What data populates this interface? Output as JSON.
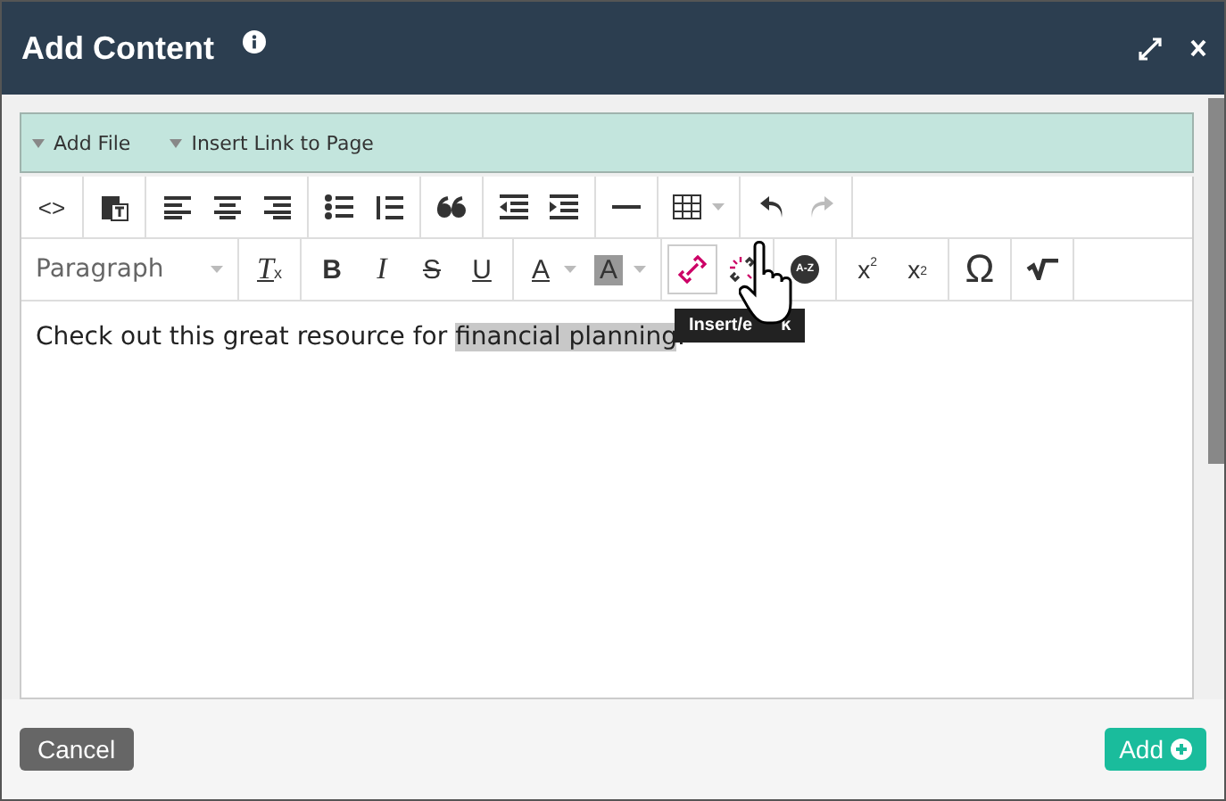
{
  "window": {
    "title": "Add Content"
  },
  "links": [
    {
      "label": "Add File"
    },
    {
      "label": "Insert Link to Page"
    }
  ],
  "toolbar": [
    [
      [
        {
          "kind": "code",
          "label": "<>"
        }
      ],
      [
        {
          "kind": "paste"
        }
      ],
      [
        {
          "kind": "align-left"
        },
        {
          "kind": "align-center"
        },
        {
          "kind": "align-right"
        }
      ],
      [
        {
          "kind": "bullets"
        },
        {
          "kind": "numbers"
        }
      ],
      [
        {
          "kind": "quote"
        }
      ],
      [
        {
          "kind": "outdent"
        },
        {
          "kind": "indent"
        }
      ],
      [
        {
          "kind": "rule"
        }
      ],
      [
        {
          "kind": "table",
          "dropdown": true
        }
      ],
      [
        {
          "kind": "undo",
          "disabled": false
        },
        {
          "kind": "redo",
          "disabled": true
        }
      ]
    ],
    [
      [
        {
          "kind": "select",
          "label": "Paragraph"
        }
      ],
      [
        {
          "kind": "clear",
          "label": "T",
          "index": "x"
        }
      ],
      [
        {
          "kind": "bold",
          "label": "B"
        },
        {
          "kind": "italic",
          "label": "I"
        },
        {
          "kind": "strike",
          "label": "S"
        },
        {
          "kind": "underline",
          "label": "U"
        }
      ],
      [
        {
          "kind": "forecolor",
          "label": "A",
          "dropdown": true
        },
        {
          "kind": "backcolor",
          "label": "A",
          "dropdown": true
        }
      ],
      [
        {
          "kind": "link",
          "hovered": true
        },
        {
          "kind": "unlink"
        }
      ],
      [
        {
          "kind": "az",
          "label": "A-Z"
        }
      ],
      [
        {
          "kind": "sup",
          "label": "x",
          "index": "2"
        },
        {
          "kind": "sub",
          "label": "x",
          "index": "2"
        }
      ],
      [
        {
          "kind": "omega",
          "label": "Ω"
        }
      ],
      [
        {
          "kind": "sqrt"
        }
      ]
    ]
  ],
  "tooltip": {
    "parts": [
      "Insert/e",
      "k"
    ]
  },
  "content": {
    "before": "Check out this great resource for ",
    "selected": "financial planning",
    "after": "."
  },
  "footer": {
    "cancel": "Cancel",
    "add": "Add"
  }
}
